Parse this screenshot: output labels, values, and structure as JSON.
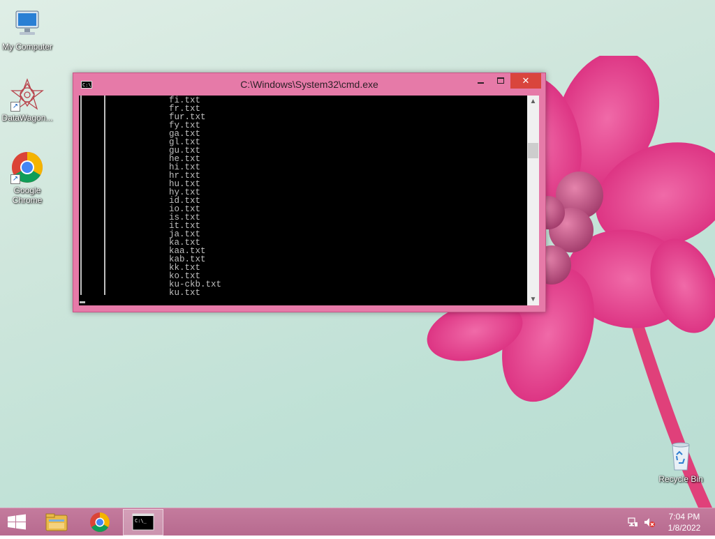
{
  "desktop": {
    "icons": [
      {
        "label": "My Computer",
        "icon": "computer-icon"
      },
      {
        "label": "DataWagon...",
        "icon": "datawagon-app-icon"
      },
      {
        "label": "Google Chrome",
        "icon": "chrome-icon"
      },
      {
        "label": "Recycle Bin",
        "icon": "recycle-bin-icon"
      }
    ]
  },
  "cmd_window": {
    "title": "C:\\Windows\\System32\\cmd.exe",
    "icon_text": "C:\\",
    "lines": [
      "fi.txt",
      "fr.txt",
      "fur.txt",
      "fy.txt",
      "ga.txt",
      "gl.txt",
      "gu.txt",
      "he.txt",
      "hi.txt",
      "hr.txt",
      "hu.txt",
      "hy.txt",
      "id.txt",
      "io.txt",
      "is.txt",
      "it.txt",
      "ja.txt",
      "ka.txt",
      "kaa.txt",
      "kab.txt",
      "kk.txt",
      "ko.txt",
      "ku-ckb.txt",
      "ku.txt"
    ],
    "close_glyph": "✕",
    "scroll_up_glyph": "▲",
    "scroll_down_glyph": "▼"
  },
  "taskbar": {
    "items": [
      "start-icon",
      "file-explorer-icon",
      "chrome-icon",
      "cmd-icon"
    ],
    "cmd_icon_text": "C:\\_"
  },
  "tray": {
    "time": "7:04 PM",
    "date": "1/8/2022"
  },
  "colors": {
    "window_frame": "#e67aa8",
    "close_button": "#d9453d",
    "console_bg": "#000000",
    "console_text": "#c0c0c0",
    "taskbar": "#b76a8f"
  }
}
